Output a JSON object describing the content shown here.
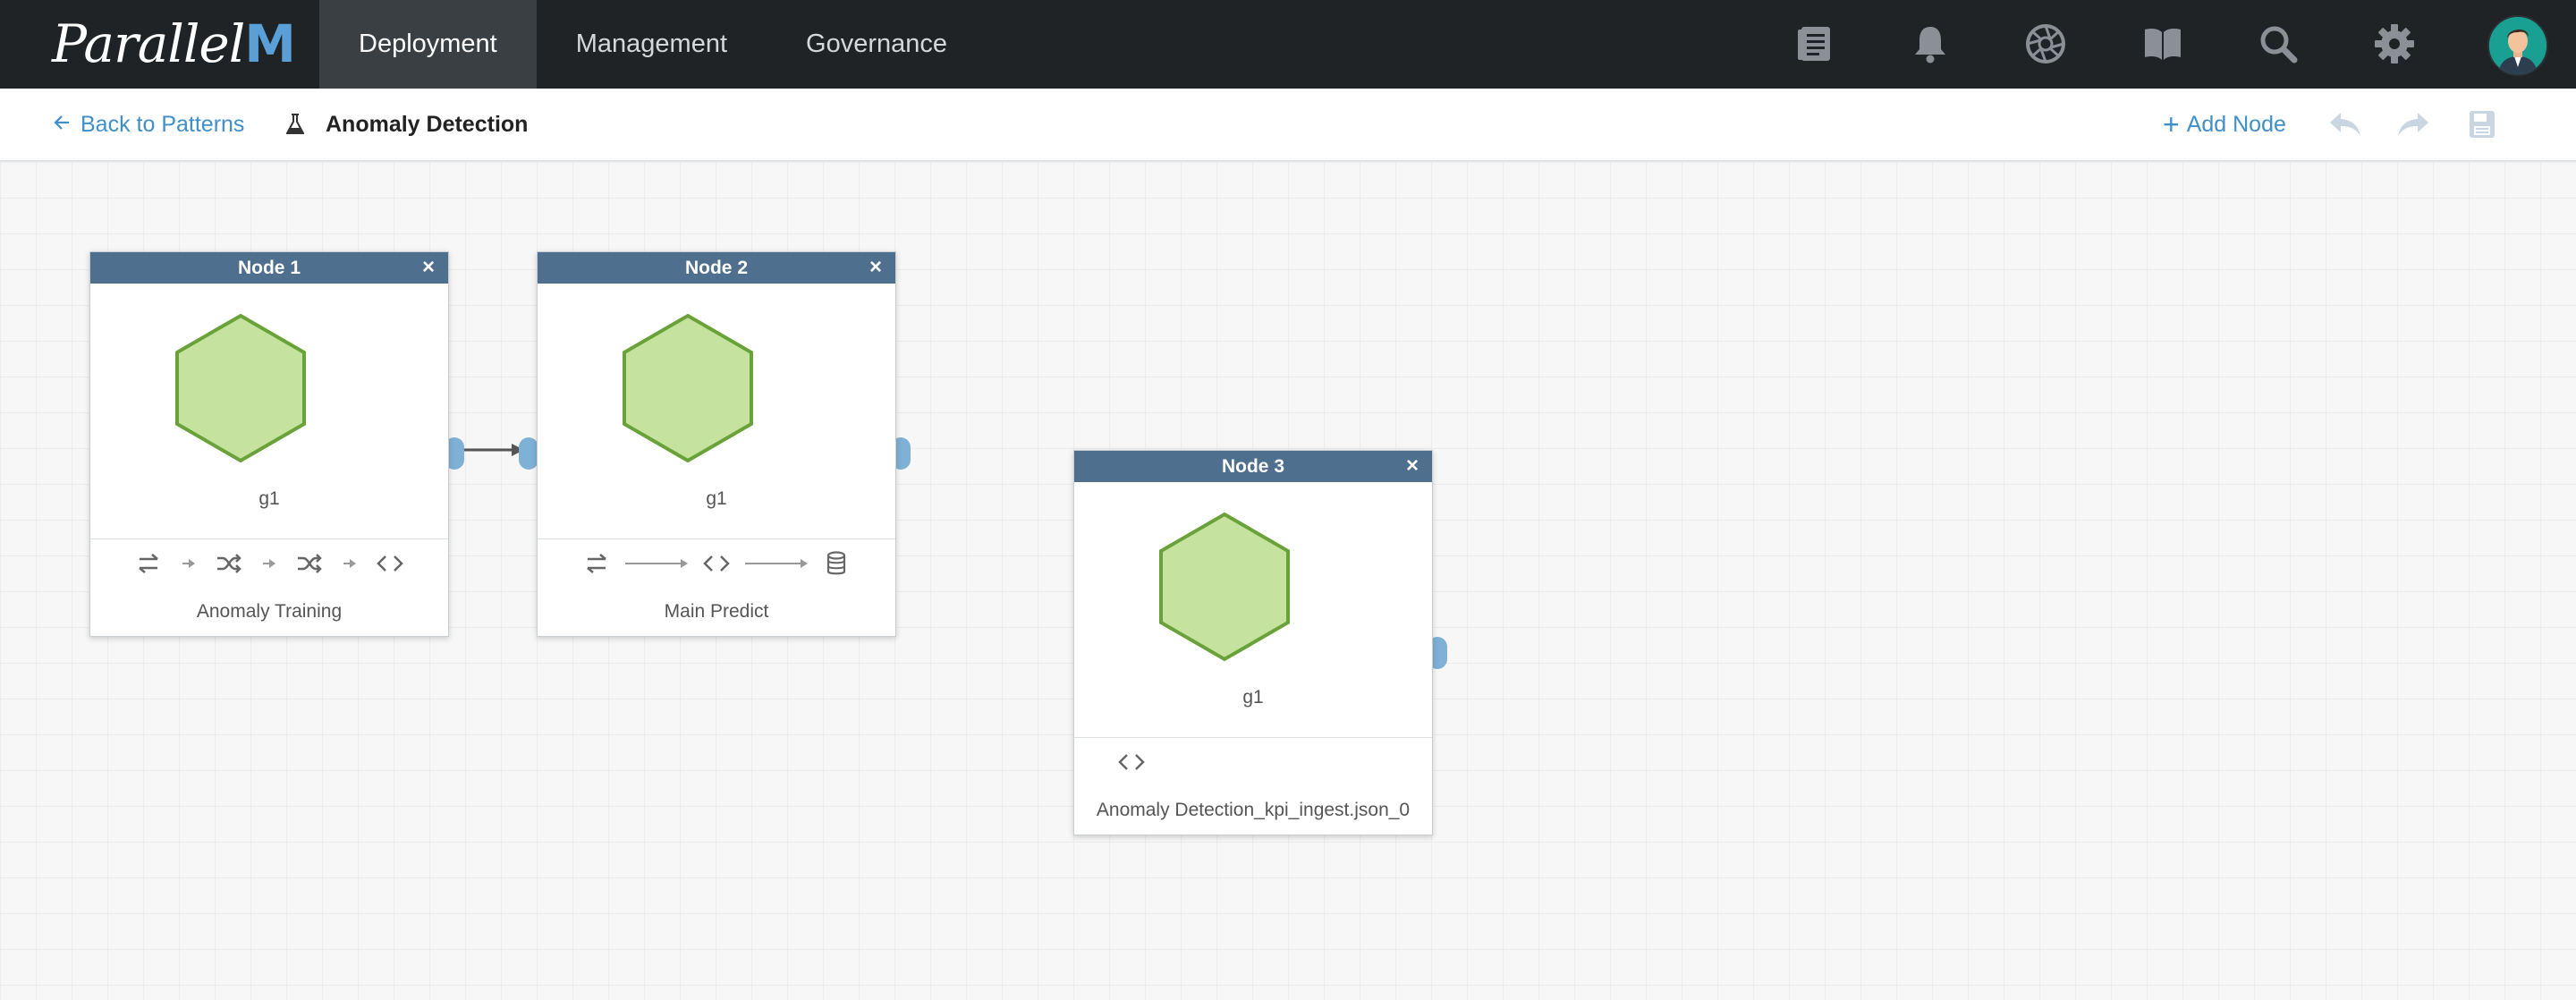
{
  "app": {
    "brand_left": "Parallel",
    "brand_right": "M",
    "nav": [
      {
        "label": "Deployment",
        "active": true
      },
      {
        "label": "Management",
        "active": false
      },
      {
        "label": "Governance",
        "active": false
      }
    ],
    "icons": [
      "list-icon",
      "bell-icon",
      "aperture-icon",
      "book-icon",
      "search-icon",
      "gear-icon",
      "avatar"
    ]
  },
  "toolbar": {
    "back_label": "Back to Patterns",
    "pattern_name": "Anomaly Detection",
    "add_node_label": "Add Node",
    "icons": [
      "undo-icon",
      "redo-icon",
      "save-icon"
    ]
  },
  "nodes": [
    {
      "title": "Node 1",
      "close": "×",
      "group": "g1",
      "pipeline": [
        "transfer-icon",
        "arrow",
        "shuffle-icon",
        "arrow",
        "shuffle-icon",
        "arrow",
        "code-icon"
      ],
      "label": "Anomaly Training"
    },
    {
      "title": "Node 2",
      "close": "×",
      "group": "g1",
      "pipeline": [
        "transfer-icon",
        "long-arrow",
        "code-icon",
        "long-arrow",
        "database-icon"
      ],
      "label": "Main Predict"
    },
    {
      "title": "Node 3",
      "close": "×",
      "group": "g1",
      "pipeline": [
        "code-icon"
      ],
      "label": "Anomaly Detection_kpi_ingest.json_0"
    }
  ],
  "colors": {
    "navbar": "#1f2326",
    "nav_active": "#3a3f44",
    "link": "#3f8fc9",
    "node_header": "#4f6f8f",
    "hex_fill": "#c5e39e",
    "hex_stroke": "#6aa23a",
    "connector": "#7fb0d6"
  }
}
